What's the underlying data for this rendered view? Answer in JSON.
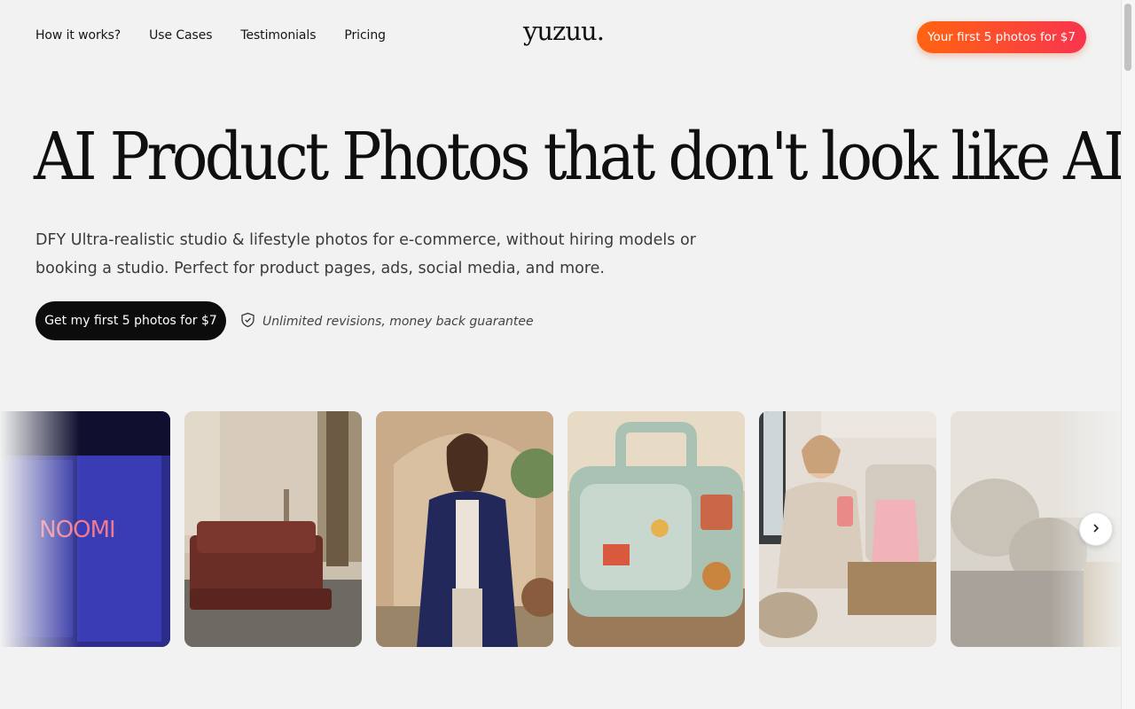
{
  "nav": {
    "links": [
      "How it works?",
      "Use Cases",
      "Testimonials",
      "Pricing"
    ],
    "logo": "yuzuu.",
    "cta_label": "Your first 5 photos for $7"
  },
  "hero": {
    "title": "AI Product Photos that don't look like AI",
    "subtitle": "DFY Ultra-realistic studio & lifestyle photos for e-commerce, without hiring models or booking a studio. Perfect for product pages, ads, social media, and more.",
    "cta_label": "Get my first 5 photos for $7",
    "guarantee": "Unlimited revisions, money back guarantee"
  },
  "gallery": {
    "product_text": "NOOMI",
    "cards": [
      {
        "subject": "blue supplement pouches"
      },
      {
        "subject": "red sofa in living room"
      },
      {
        "subject": "woman in navy kimono"
      },
      {
        "subject": "mint retro tv toy"
      },
      {
        "subject": "woman drinking pink smoothie"
      },
      {
        "subject": "bedroom with pillows"
      }
    ],
    "next_icon": "chevron-right-icon"
  },
  "colors": {
    "background": "#f1f2f1",
    "cta_gradient_start": "#ff6410",
    "cta_gradient_end": "#f8344f",
    "primary_button": "#0c0c0c"
  }
}
